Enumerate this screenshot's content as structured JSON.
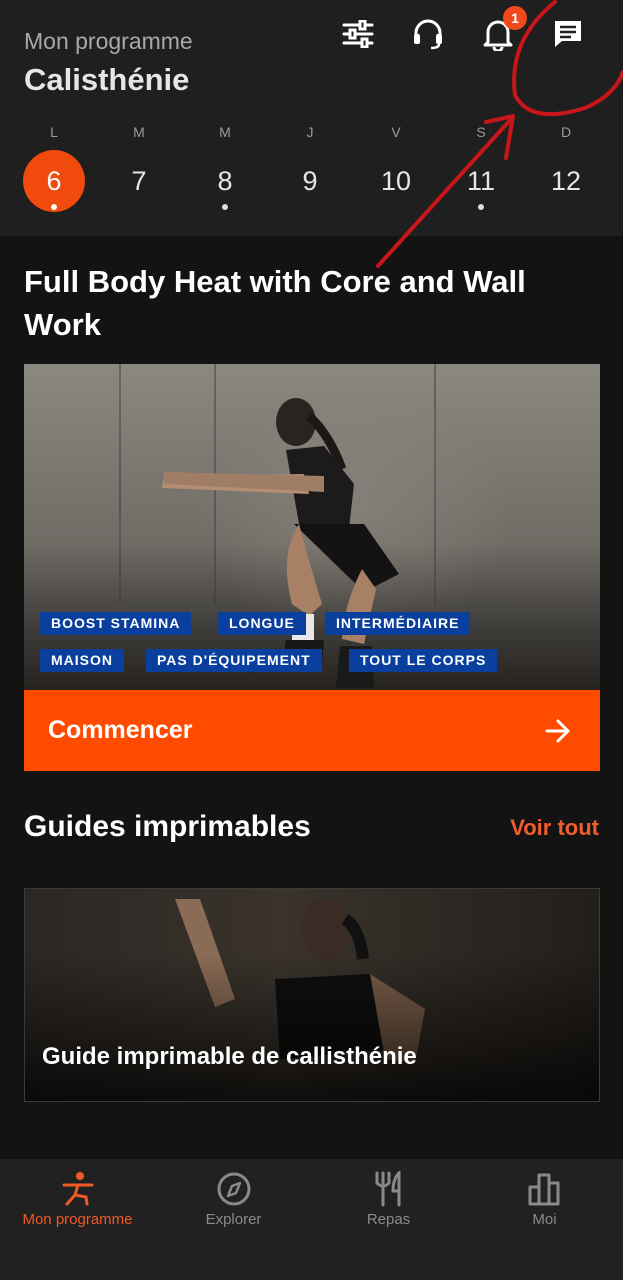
{
  "header": {
    "subtitle": "Mon programme",
    "title": "Calisthénie",
    "notification_count": "1",
    "icons": [
      "sliders-icon",
      "headset-icon",
      "bell-icon",
      "chat-icon"
    ]
  },
  "week": {
    "days": [
      {
        "letter": "L",
        "num": "6",
        "active": true,
        "dot": true
      },
      {
        "letter": "M",
        "num": "7",
        "active": false,
        "dot": false
      },
      {
        "letter": "M",
        "num": "8",
        "active": false,
        "dot": true
      },
      {
        "letter": "J",
        "num": "9",
        "active": false,
        "dot": false
      },
      {
        "letter": "V",
        "num": "10",
        "active": false,
        "dot": false
      },
      {
        "letter": "S",
        "num": "11",
        "active": false,
        "dot": true
      },
      {
        "letter": "D",
        "num": "12",
        "active": false,
        "dot": false
      }
    ]
  },
  "workout": {
    "title": "Full Body Heat with Core and Wall Work",
    "tags": [
      "BOOST STAMINA",
      "LONGUE",
      "INTERMÉDIAIRE",
      "MAISON",
      "PAS D'ÉQUIPEMENT",
      "TOUT LE CORPS"
    ],
    "cta_label": "Commencer"
  },
  "guides": {
    "title": "Guides imprimables",
    "see_all": "Voir tout",
    "card_title": "Guide imprimable de callisthénie"
  },
  "nav": {
    "items": [
      {
        "label": "Mon programme",
        "icon": "stretch-person-icon",
        "active": true
      },
      {
        "label": "Explorer",
        "icon": "compass-icon",
        "active": false
      },
      {
        "label": "Repas",
        "icon": "fork-knife-icon",
        "active": false
      },
      {
        "label": "Moi",
        "icon": "bar-chart-icon",
        "active": false
      }
    ]
  },
  "colors": {
    "accent": "#fe4b00",
    "tag_bg": "#0a3f9e",
    "background": "#131313",
    "header_bg": "#1f1f1f",
    "annotation_red": "#c8161a"
  }
}
